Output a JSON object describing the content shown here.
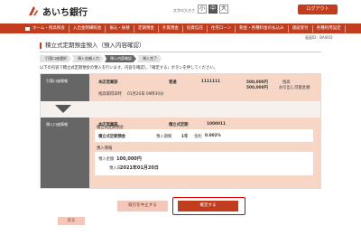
{
  "header": {
    "bank_name": "あいち銀行",
    "font_size_label": "文字の大きさ",
    "font_sizes": [
      "小",
      "中",
      "大"
    ],
    "logout": "ログアウト"
  },
  "nav": {
    "items": [
      "ホーム・残高照会",
      "入出金明細照会",
      "振込・振替",
      "定期預金",
      "外貨預金",
      "投資信託",
      "住宅ローン",
      "税金・各種料金の払込み",
      "諸届受付",
      "各種利用設定"
    ]
  },
  "screen_id": "画面ID：BAI003",
  "page_title": "積立式定期預金預入（預入内容確認）",
  "steps": [
    "引落口座選択",
    "預入金額入力",
    "預入内容確認",
    "預入完了"
  ],
  "instruction": "以下の内容で積立式定期預金の預入を行います。内容を確認し「確定する」ボタンを押してください。",
  "withdraw": {
    "section_label": "引落口座情報",
    "branch": "本店営業部",
    "type": "普通",
    "account": "1111111",
    "amount1": "500,000円",
    "amount1_label": "残高",
    "amount2": "500,000円",
    "amount2_label": "お引出し可能金額",
    "date_label": "残高取得日時",
    "date_value": "01月20日 09時30分"
  },
  "deposit": {
    "section_label": "預入口座情報",
    "branch": "本店営業部",
    "type": "積立式定期",
    "account": "1000011",
    "sub1_title": "積立式定期預金",
    "product": "積立式定期預金",
    "period_label": "預入期間",
    "period": "1年",
    "rate_label": "金利",
    "rate": "0.002%",
    "sub2_title": "預入情報",
    "amount_label": "預入金額",
    "amount": "100,000円",
    "date_label": "預入日",
    "date": "2021年01月20日"
  },
  "buttons": {
    "cancel": "取引を中止する",
    "confirm": "確定する",
    "back": "戻る"
  },
  "colors": {
    "brand": "#c23c1e",
    "highlight_border": "#e00000"
  }
}
